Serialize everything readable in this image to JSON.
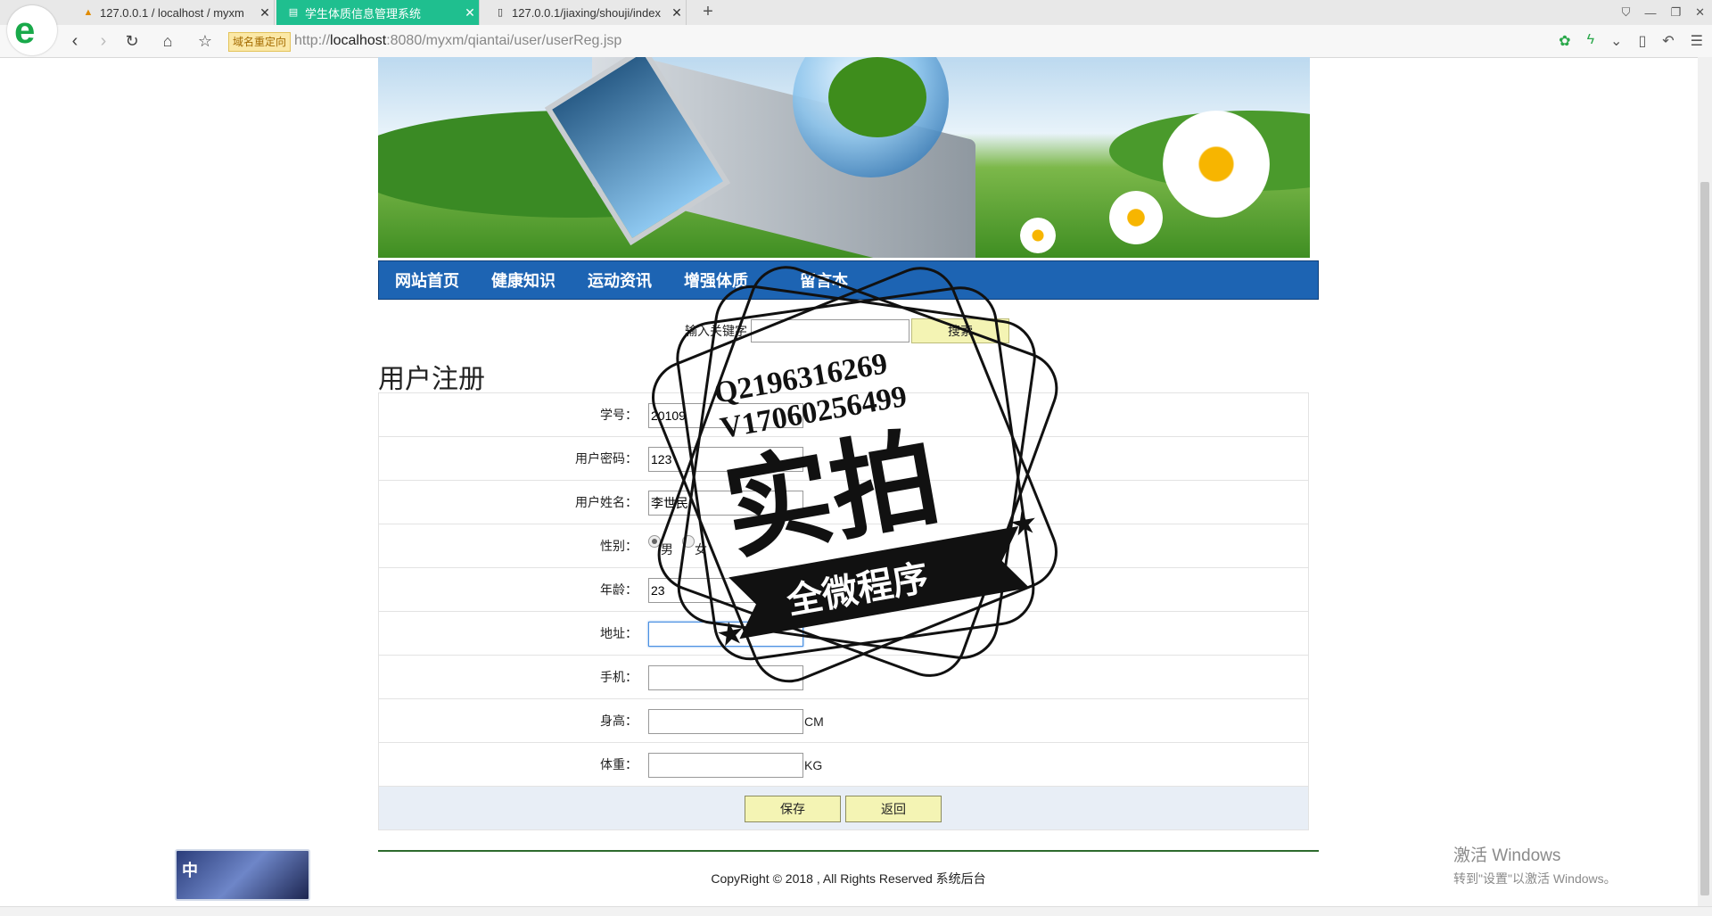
{
  "browser": {
    "tabs": [
      {
        "title": "127.0.0.1 / localhost / myxm",
        "icon": "phpmyadmin-icon"
      },
      {
        "title": "学生体质信息管理系统",
        "icon": "page-icon"
      },
      {
        "title": "127.0.0.1/jiaxing/shouji/index",
        "icon": "page-icon"
      }
    ],
    "active_tab": 1,
    "redirect_badge": "域名重定向",
    "url_prefix": "http://",
    "url_host": "localhost",
    "url_rest": ":8080/myxm/qiantai/user/userReg.jsp"
  },
  "site": {
    "nav": [
      "网站首页",
      "健康知识",
      "运动资讯",
      "增强体质",
      "留言本"
    ],
    "search_label": "输入关键字",
    "search_button": "搜索",
    "page_title": "用户注册"
  },
  "form": {
    "fields": [
      {
        "label": "学号：",
        "value": "20109",
        "unit": ""
      },
      {
        "label": "用户密码：",
        "value": "123",
        "unit": ""
      },
      {
        "label": "用户姓名：",
        "value": "李世民",
        "unit": ""
      },
      {
        "label": "性别：",
        "value": "",
        "unit": ""
      },
      {
        "label": "年龄：",
        "value": "23",
        "unit": ""
      },
      {
        "label": "地址：",
        "value": "",
        "unit": ""
      },
      {
        "label": "手机：",
        "value": "",
        "unit": ""
      },
      {
        "label": "身高：",
        "value": "",
        "unit": "CM"
      },
      {
        "label": "体重：",
        "value": "",
        "unit": "KG"
      }
    ],
    "gender_options": [
      "男",
      "女"
    ],
    "gender_selected": "男",
    "save_button": "保存",
    "back_button": "返回"
  },
  "footer": {
    "text": "CopyRight © 2018 , All Rights Reserved 系统后台"
  },
  "overlay": {
    "ime": "中",
    "windows_line1": "激活 Windows",
    "windows_line2": "转到\"设置\"以激活 Windows。",
    "stamp_line1": "Q2196316269",
    "stamp_line2": "V17060256499",
    "stamp_big": "实拍",
    "stamp_ribbon": "全微程序"
  },
  "colors": {
    "nav_bg": "#1d64b3",
    "active_tab": "#1fbf8f",
    "button_bg": "#f4f4b4",
    "footer_rule": "#2d6b2d"
  }
}
